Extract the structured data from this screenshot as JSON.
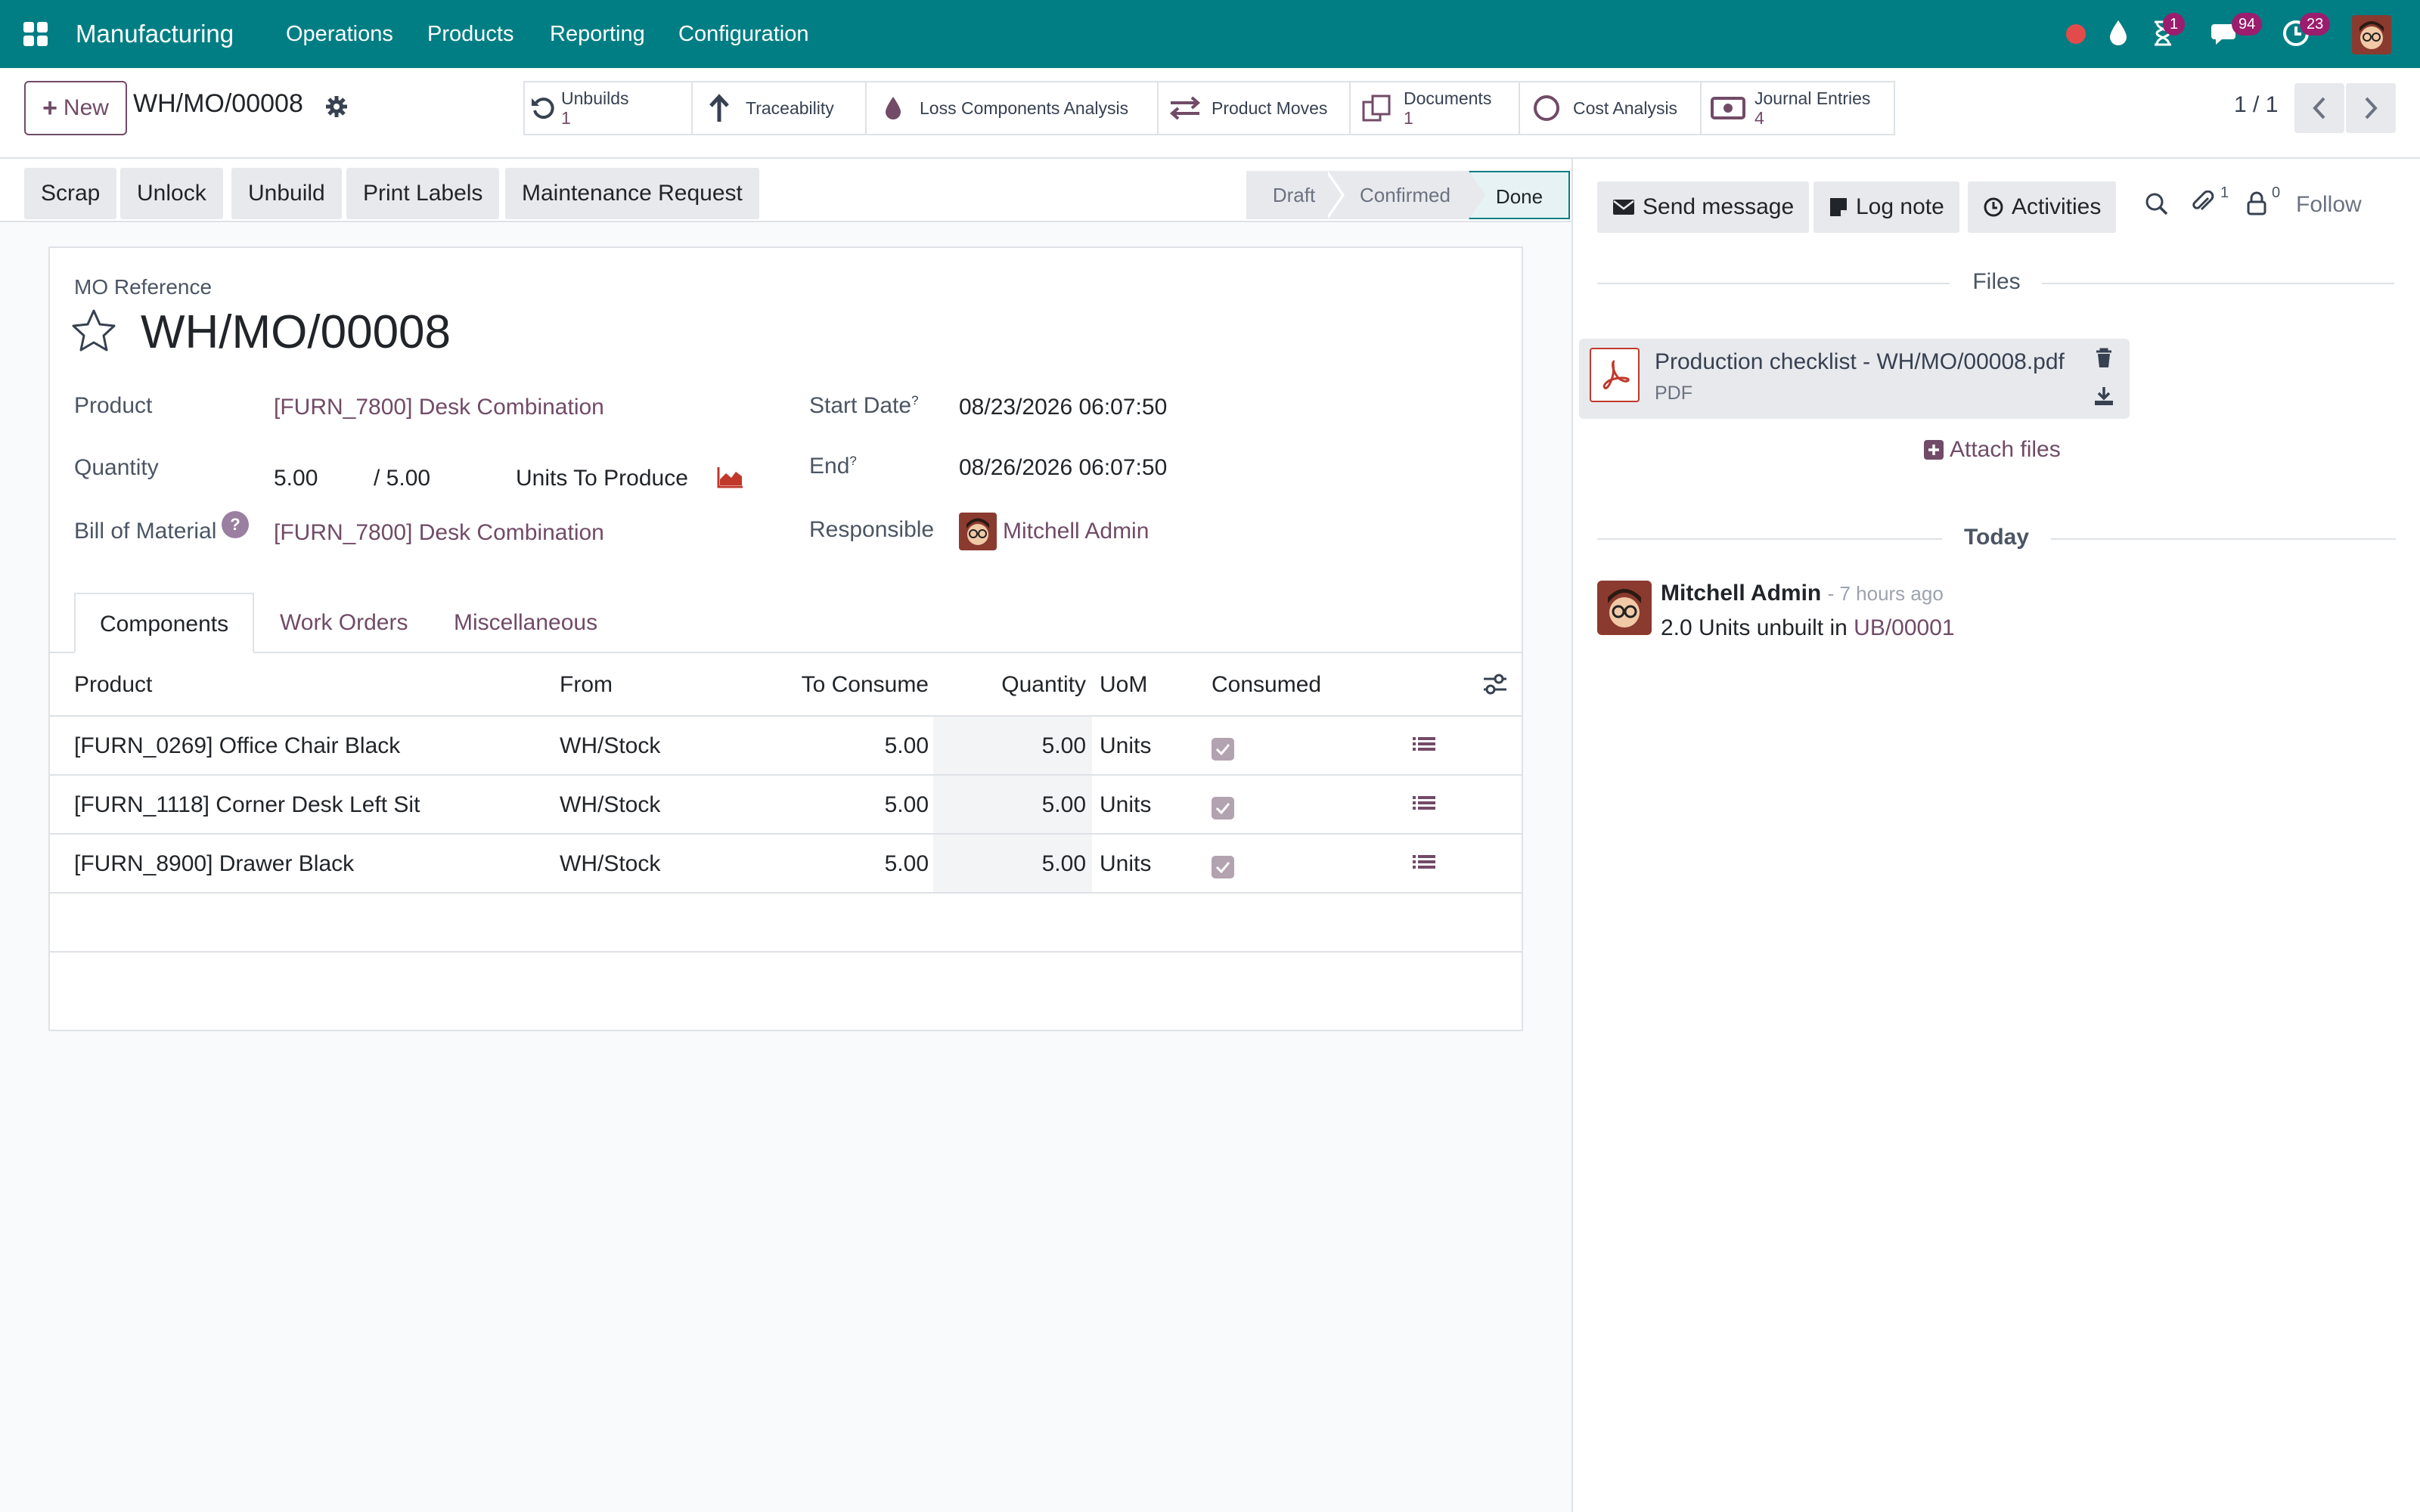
{
  "navbar": {
    "app_name": "Manufacturing",
    "menu": [
      "Operations",
      "Products",
      "Reporting",
      "Configuration"
    ],
    "badges": {
      "activities": "1",
      "messages": "94",
      "clock": "23"
    },
    "icons": [
      "apps-grid-icon",
      "recording-dot-icon",
      "drop-icon",
      "hourglass-icon",
      "chat-icon",
      "clock-icon",
      "user-avatar"
    ]
  },
  "control": {
    "new_label": "New",
    "breadcrumb": "WH/MO/00008",
    "pager": "1 / 1",
    "smart_buttons": [
      {
        "label": "Unbuilds",
        "count": "1",
        "icon": "undo-icon"
      },
      {
        "label": "Traceability",
        "count": "",
        "icon": "arrow-up-icon"
      },
      {
        "label": "Loss Components Analysis",
        "count": "",
        "icon": "drop-icon"
      },
      {
        "label": "Product Moves",
        "count": "",
        "icon": "exchange-icon"
      },
      {
        "label": "Documents",
        "count": "1",
        "icon": "files-icon"
      },
      {
        "label": "Cost Analysis",
        "count": "",
        "icon": "circle-icon"
      },
      {
        "label": "Journal Entries",
        "count": "4",
        "icon": "money-icon"
      }
    ]
  },
  "statusbar": {
    "buttons": [
      "Scrap",
      "Unlock",
      "Unbuild",
      "Print Labels",
      "Maintenance Request"
    ],
    "stages": [
      "Draft",
      "Confirmed",
      "Done"
    ],
    "current_stage": "Done"
  },
  "form": {
    "ref_label": "MO Reference",
    "ref_value": "WH/MO/00008",
    "product_label": "Product",
    "product_value": "[FURN_7800] Desk Combination",
    "quantity_label": "Quantity",
    "qty_produced": "5.00",
    "qty_total": "/ 5.00",
    "qty_uom": "Units To Produce",
    "bom_label": "Bill of Material",
    "bom_help": "?",
    "bom_value": "[FURN_7800] Desk Combination",
    "start_label": "Start Date",
    "start_help": "?",
    "start_value": "08/23/2026 06:07:50",
    "end_label": "End",
    "end_help": "?",
    "end_value": "08/26/2026 06:07:50",
    "responsible_label": "Responsible",
    "responsible_value": "Mitchell Admin"
  },
  "tabs": [
    "Components",
    "Work Orders",
    "Miscellaneous"
  ],
  "table": {
    "headers": {
      "product": "Product",
      "from": "From",
      "to_consume": "To Consume",
      "quantity": "Quantity",
      "uom": "UoM",
      "consumed": "Consumed"
    },
    "rows": [
      {
        "product": "[FURN_0269] Office Chair Black",
        "from": "WH/Stock",
        "to_consume": "5.00",
        "quantity": "5.00",
        "uom": "Units",
        "consumed": true
      },
      {
        "product": "[FURN_1118] Corner Desk Left Sit",
        "from": "WH/Stock",
        "to_consume": "5.00",
        "quantity": "5.00",
        "uom": "Units",
        "consumed": true
      },
      {
        "product": "[FURN_8900] Drawer Black",
        "from": "WH/Stock",
        "to_consume": "5.00",
        "quantity": "5.00",
        "uom": "Units",
        "consumed": true
      }
    ]
  },
  "chatter": {
    "send_message": "Send message",
    "log_note": "Log note",
    "activities": "Activities",
    "attachments_count": "1",
    "followers_count": "0",
    "follow": "Follow",
    "files_title": "Files",
    "file_name": "Production checklist - WH/MO/00008.pdf",
    "file_type": "PDF",
    "attach_files": "Attach files",
    "today": "Today",
    "message": {
      "author": "Mitchell Admin",
      "time": "- 7 hours ago",
      "body": "2.0 Units unbuilt in",
      "link": "UB/00001"
    }
  },
  "colors": {
    "brand": "#017e84",
    "accent": "#714b67",
    "badge": "#9b1d6e",
    "pdf": "#c0392b"
  }
}
